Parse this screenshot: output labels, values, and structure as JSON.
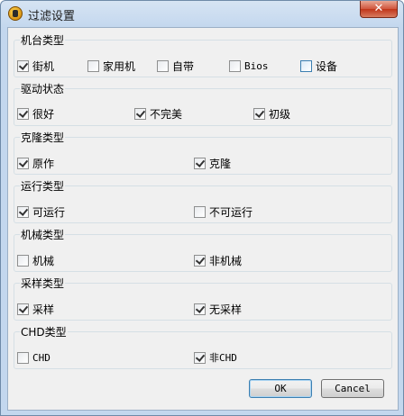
{
  "window": {
    "title": "过滤设置",
    "close_label": "✕"
  },
  "groups": {
    "machine_type": {
      "title": "机台类型",
      "items": [
        {
          "label": "街机",
          "checked": true
        },
        {
          "label": "家用机",
          "checked": false
        },
        {
          "label": "自带",
          "checked": false
        },
        {
          "label": "Bios",
          "checked": false
        },
        {
          "label": "设备",
          "checked": false
        }
      ]
    },
    "driver_status": {
      "title": "驱动状态",
      "items": [
        {
          "label": "很好",
          "checked": true
        },
        {
          "label": "不完美",
          "checked": true
        },
        {
          "label": "初级",
          "checked": true
        }
      ]
    },
    "clone_type": {
      "title": "克隆类型",
      "items": [
        {
          "label": "原作",
          "checked": true
        },
        {
          "label": "克隆",
          "checked": true
        }
      ]
    },
    "run_type": {
      "title": "运行类型",
      "items": [
        {
          "label": "可运行",
          "checked": true
        },
        {
          "label": "不可运行",
          "checked": false
        }
      ]
    },
    "mech_type": {
      "title": "机械类型",
      "items": [
        {
          "label": "机械",
          "checked": false
        },
        {
          "label": "非机械",
          "checked": true
        }
      ]
    },
    "sample_type": {
      "title": "采样类型",
      "items": [
        {
          "label": "采样",
          "checked": true
        },
        {
          "label": "无采样",
          "checked": true
        }
      ]
    },
    "chd_type": {
      "title": "CHD类型",
      "items": [
        {
          "label": "CHD",
          "checked": false
        },
        {
          "label": "非CHD",
          "checked": true
        }
      ]
    }
  },
  "buttons": {
    "ok": "OK",
    "cancel": "Cancel"
  }
}
